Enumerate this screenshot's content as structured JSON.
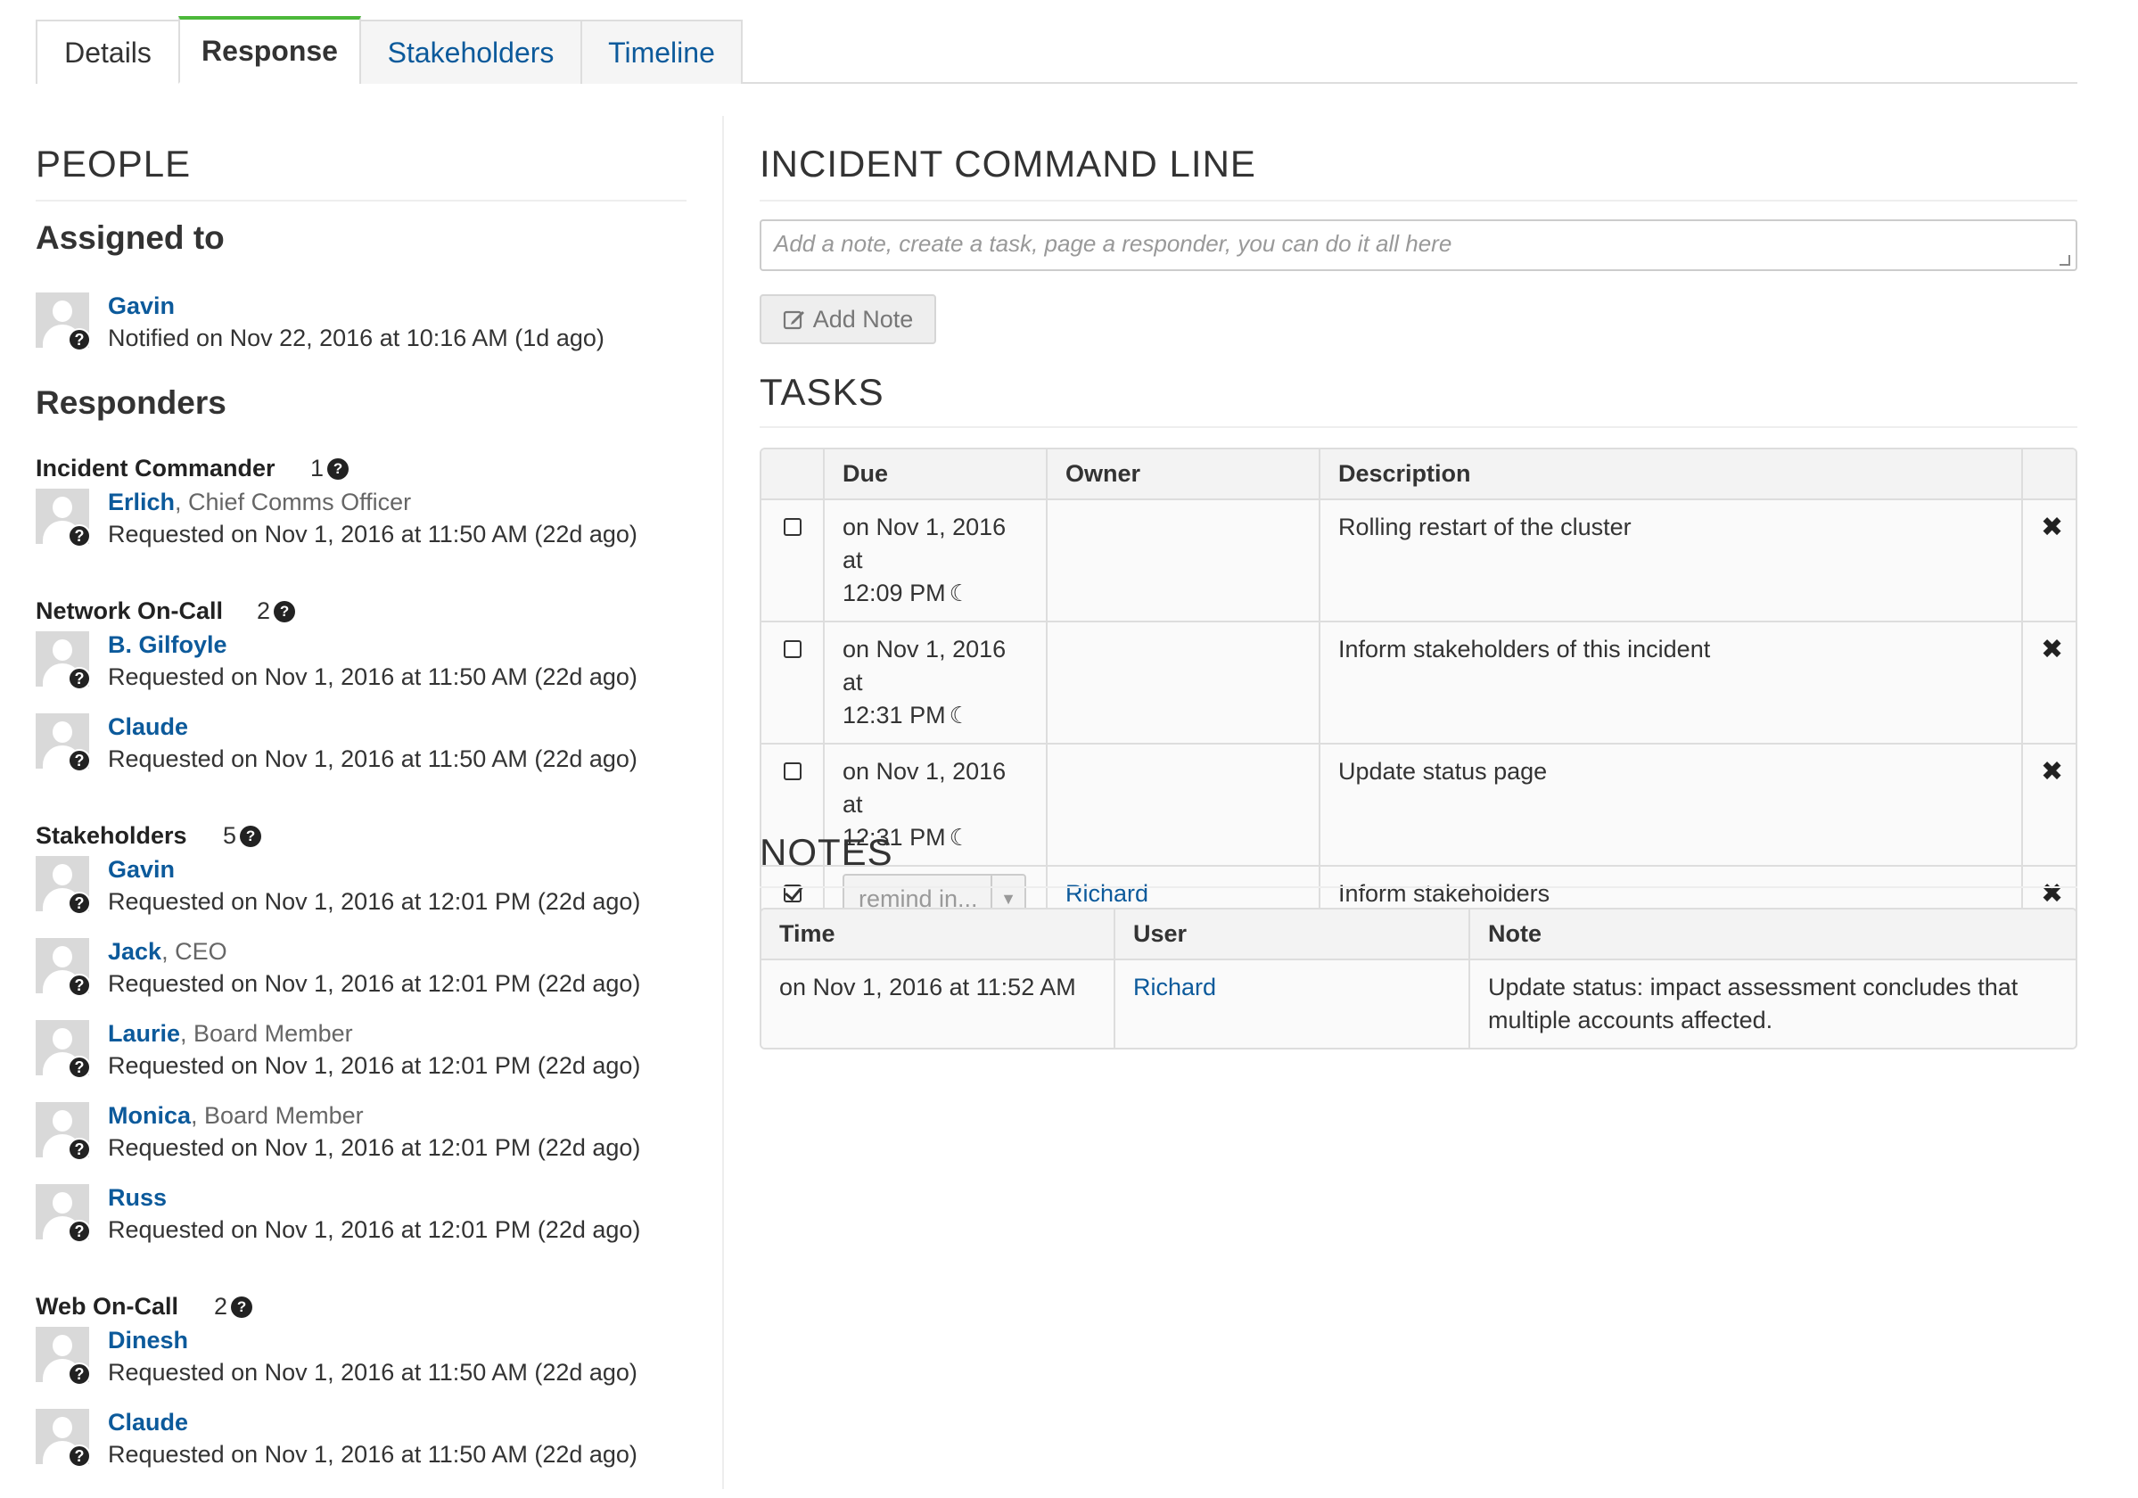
{
  "tabs": [
    {
      "label": "Details"
    },
    {
      "label": "Response"
    },
    {
      "label": "Stakeholders"
    },
    {
      "label": "Timeline"
    }
  ],
  "people": {
    "heading": "PEOPLE",
    "assigned_heading": "Assigned to",
    "assigned": {
      "name": "Gavin",
      "line": "Notified on Nov 22, 2016 at 10:16 AM (1d ago)"
    },
    "responders_heading": "Responders",
    "roles": [
      {
        "name": "Incident Commander",
        "count": "1",
        "people": [
          {
            "name": "Erlich",
            "title": ", Chief Comms Officer",
            "line": "Requested on Nov 1, 2016 at 11:50 AM (22d ago)"
          }
        ]
      },
      {
        "name": "Network On-Call",
        "count": "2",
        "people": [
          {
            "name": "B. Gilfoyle",
            "title": "",
            "line": "Requested on Nov 1, 2016 at 11:50 AM (22d ago)"
          },
          {
            "name": "Claude",
            "title": "",
            "line": "Requested on Nov 1, 2016 at 11:50 AM (22d ago)"
          }
        ]
      },
      {
        "name": "Stakeholders",
        "count": "5",
        "people": [
          {
            "name": "Gavin",
            "title": "",
            "line": "Requested on Nov 1, 2016 at 12:01 PM (22d ago)"
          },
          {
            "name": "Jack",
            "title": ", CEO",
            "line": "Requested on Nov 1, 2016 at 12:01 PM (22d ago)"
          },
          {
            "name": "Laurie",
            "title": ", Board Member",
            "line": "Requested on Nov 1, 2016 at 12:01 PM (22d ago)"
          },
          {
            "name": "Monica",
            "title": ", Board Member",
            "line": "Requested on Nov 1, 2016 at 12:01 PM (22d ago)"
          },
          {
            "name": "Russ",
            "title": "",
            "line": "Requested on Nov 1, 2016 at 12:01 PM (22d ago)"
          }
        ]
      },
      {
        "name": "Web On-Call",
        "count": "2",
        "people": [
          {
            "name": "Dinesh",
            "title": "",
            "line": "Requested on Nov 1, 2016 at 11:50 AM (22d ago)"
          },
          {
            "name": "Claude",
            "title": "",
            "line": "Requested on Nov 1, 2016 at 11:50 AM (22d ago)"
          }
        ]
      }
    ]
  },
  "command": {
    "heading": "INCIDENT COMMAND LINE",
    "placeholder": "Add a note, create a task, page a responder, you can do it all here",
    "add_note_label": "Add Note"
  },
  "tasks": {
    "heading": "TASKS",
    "columns": [
      "",
      "Due",
      "Owner",
      "Description",
      ""
    ],
    "rows": [
      {
        "checked": false,
        "due1": "on Nov 1, 2016 at",
        "due2": "12:09 PM",
        "owner": "",
        "description": "Rolling restart of the cluster"
      },
      {
        "checked": false,
        "due1": "on Nov 1, 2016 at",
        "due2": "12:31 PM",
        "owner": "",
        "description": "Inform stakeholders of this incident"
      },
      {
        "checked": false,
        "due1": "on Nov 1, 2016 at",
        "due2": "12:31 PM",
        "owner": "",
        "description": "Update status page"
      },
      {
        "checked": true,
        "remind": "remind in...",
        "owner": "Richard",
        "description": "Inform stakeholders"
      }
    ]
  },
  "notes": {
    "heading": "NOTES",
    "columns": [
      "Time",
      "User",
      "Note"
    ],
    "rows": [
      {
        "time": "on Nov 1, 2016 at 11:52 AM",
        "user": "Richard",
        "note": "Update status: impact assessment concludes that multiple accounts affected."
      }
    ]
  },
  "icons": {
    "help": "question-circle-icon",
    "moon": "moon-icon",
    "remove": "times-icon",
    "edit": "pencil-square-icon",
    "caret": "caret-down-icon"
  },
  "colors": {
    "link": "#0c5a9b",
    "active_tab": "#4cb83a"
  }
}
